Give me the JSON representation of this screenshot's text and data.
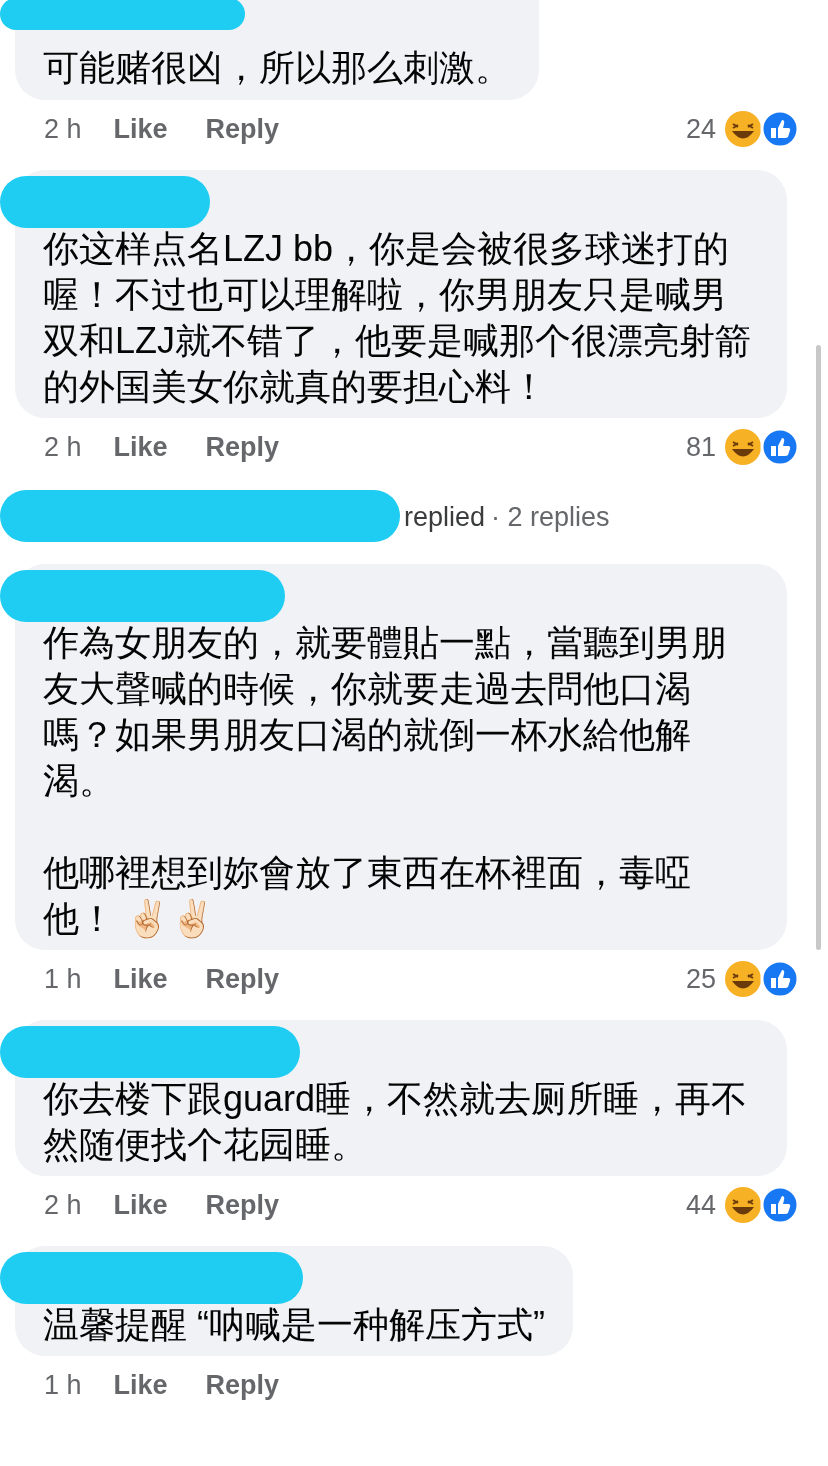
{
  "items": [
    {
      "kind": "comment",
      "text": "可能赌很凶，所以那么刺激。",
      "time": "2 h",
      "like": "Like",
      "reply": "Reply",
      "reaction_count": "24"
    },
    {
      "kind": "comment",
      "text": "你这样点名LZJ bb，你是会被很多球迷打的喔！不过也可以理解啦，你男朋友只是喊男双和LZJ就不错了，他要是喊那个很漂亮射箭的外国美女你就真的要担心料！",
      "time": "2 h",
      "like": "Like",
      "reply": "Reply",
      "reaction_count": "81"
    },
    {
      "kind": "replies",
      "verb": "replied",
      "count": "· 2 replies"
    },
    {
      "kind": "comment",
      "text": "作為女朋友的，就要體貼一點，當聽到男朋友大聲喊的時候，你就要走過去問他口渴嗎？如果男朋友口渴的就倒一杯水給他解渴。",
      "text_2": "他哪裡想到妳會放了東西在杯裡面，毒啞他！ ✌🏻✌🏻",
      "time": "1 h",
      "like": "Like",
      "reply": "Reply",
      "reaction_count": "25"
    },
    {
      "kind": "comment",
      "text": "你去楼下跟guard睡，不然就去厕所睡，再不然随便找个花园睡。",
      "time": "2 h",
      "like": "Like",
      "reply": "Reply",
      "reaction_count": "44"
    },
    {
      "kind": "comment",
      "text": "温馨提醒 “呐喊是一种解压方式”",
      "time": "1 h",
      "like": "Like",
      "reply": "Reply"
    }
  ]
}
